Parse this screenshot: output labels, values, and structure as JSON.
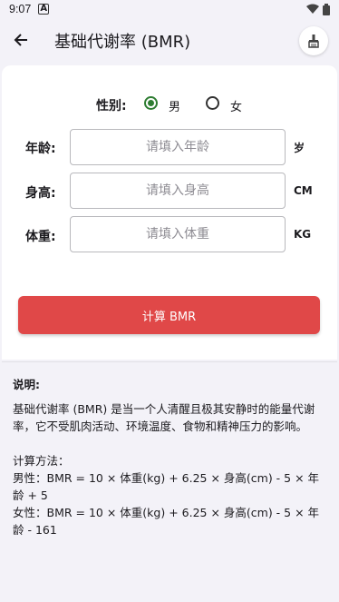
{
  "status_bar": {
    "time": "9:07",
    "notif": "A"
  },
  "app_bar": {
    "title": "基础代谢率 (BMR)"
  },
  "form": {
    "gender_label": "性别:",
    "gender_options": [
      "男",
      "女"
    ],
    "gender_selected": "男",
    "age": {
      "label": "年龄:",
      "placeholder": "请填入年龄",
      "value": "",
      "unit": "岁"
    },
    "height": {
      "label": "身高:",
      "placeholder": "请填入身高",
      "value": "",
      "unit": "CM"
    },
    "weight": {
      "label": "体重:",
      "placeholder": "请填入体重",
      "value": "",
      "unit": "KG"
    },
    "calculate_label": "计算 BMR"
  },
  "description": {
    "title": "说明:",
    "text": "基础代谢率 (BMR) 是当一个人清醒且极其安静时的能量代谢率，它不受肌肉活动、环境温度、食物和精神压力的影响。",
    "method_title": "计算方法：",
    "male_formula": "男性：BMR = 10 × 体重(kg) + 6.25 × 身高(cm) - 5 × 年龄 + 5",
    "female_formula": "女性：BMR = 10 × 体重(kg) + 6.25 × 身高(cm) - 5 × 年龄 - 161"
  },
  "colors": {
    "accent": "#e04848",
    "radio_checked": "#2e7d32",
    "background": "#f3f2f8"
  }
}
